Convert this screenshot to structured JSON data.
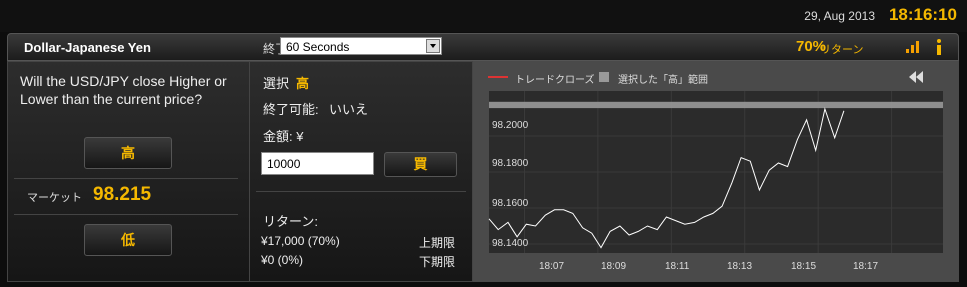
{
  "topbar": {
    "date": "29, Aug 2013",
    "time": "18:16:10"
  },
  "header": {
    "asset": "Dollar-Japanese Yen",
    "expiry_label": "終了",
    "expiry_value": "60 Seconds",
    "payout_percent": "70%",
    "payout_label": "リターン"
  },
  "left": {
    "question": "Will the USD/JPY close Higher or Lower than the current price?",
    "high_button": "高",
    "low_button": "低",
    "market_label": "マーケット",
    "market_price": "98.215"
  },
  "middle": {
    "selection_label": "選択",
    "selection_value": "高",
    "closable_label": "終了可能:",
    "closable_value": "いいえ",
    "amount_label": "金額: ¥",
    "amount_value": "10000",
    "buy_button": "買",
    "return_label": "リターン:",
    "upper_amount": "¥17,000 (70%)",
    "upper_label": "上期限",
    "lower_amount": "¥0 (0%)",
    "lower_label": "下期限"
  },
  "chart_data": {
    "type": "line",
    "legend": [
      "トレードクローズ",
      "選択した「高」範囲"
    ],
    "colors": {
      "trade_close": "#dd3333",
      "selected_range": "#999999",
      "price_line": "#ffffff",
      "background": "#4a4a4a"
    },
    "x_ticks": [
      "18:07",
      "18:09",
      "18:11",
      "18:13",
      "18:15",
      "18:17"
    ],
    "y_ticks": [
      "98.2000",
      "98.1800",
      "98.1600",
      "98.1400"
    ],
    "ylim": [
      98.135,
      98.225
    ],
    "xlim": [
      "18:06:02",
      "18:18:24"
    ],
    "selected_range": [
      98.2155,
      98.219
    ],
    "x": [
      "18:06:02",
      "18:06:17",
      "18:06:33",
      "18:06:48",
      "18:07:03",
      "18:07:18",
      "18:07:34",
      "18:07:49",
      "18:08:04",
      "18:08:19",
      "18:08:35",
      "18:08:50",
      "18:09:05",
      "18:09:20",
      "18:09:36",
      "18:09:51",
      "18:10:06",
      "18:10:21",
      "18:10:37",
      "18:10:52",
      "18:11:07",
      "18:11:22",
      "18:11:38",
      "18:11:53",
      "18:12:08",
      "18:12:23",
      "18:12:39",
      "18:12:54",
      "18:13:09",
      "18:13:24",
      "18:13:40",
      "18:13:55",
      "18:14:10",
      "18:14:26",
      "18:14:41",
      "18:14:56",
      "18:15:11",
      "18:15:27",
      "18:15:42"
    ],
    "values": [
      98.154,
      98.148,
      98.152,
      98.144,
      98.151,
      98.15,
      98.156,
      98.159,
      98.159,
      98.157,
      98.149,
      98.146,
      98.138,
      98.147,
      98.15,
      98.145,
      98.147,
      98.15,
      98.148,
      98.155,
      98.153,
      98.151,
      98.152,
      98.155,
      98.157,
      98.161,
      98.174,
      98.188,
      98.186,
      98.17,
      98.181,
      98.185,
      98.183,
      98.198,
      98.209,
      98.192,
      98.215,
      98.199,
      98.214
    ]
  }
}
